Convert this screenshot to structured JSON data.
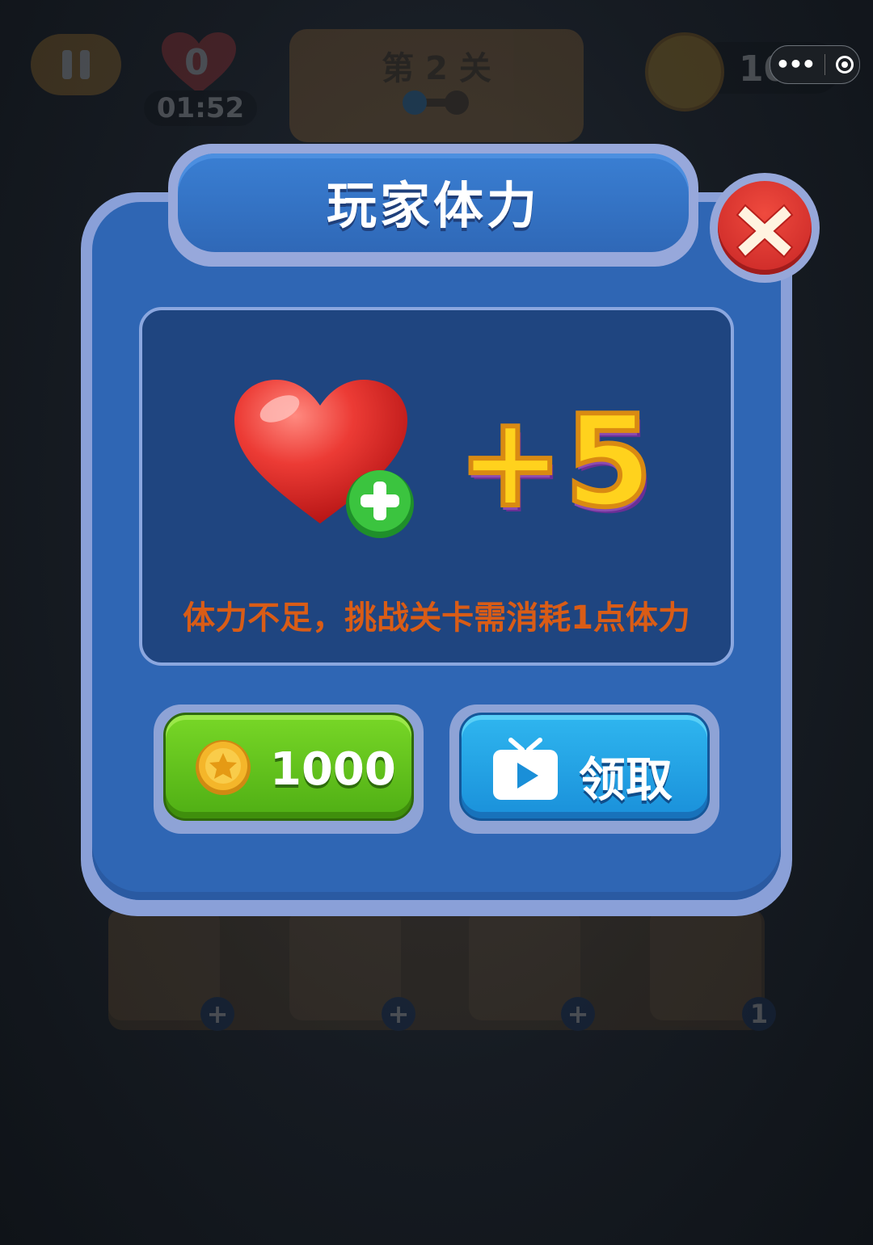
{
  "hud": {
    "lives": "0",
    "timer": "01:52",
    "level_title": "第 2 关",
    "coins": "1020",
    "tool_badge": "1"
  },
  "dialog": {
    "title": "玩家体力",
    "reward_amount": "+5",
    "notice": "体力不足，挑战关卡需消耗1点体力",
    "coin_button_label": "1000",
    "ad_button_label": "领取"
  },
  "colors": {
    "panel_blue": "#2f66b4",
    "panel_border": "#8aa0d8",
    "notice_orange": "#d95c16",
    "reward_yellow": "#ffd21d",
    "green_button": "#5cbf18",
    "blue_button": "#1f9fe3",
    "close_red": "#d63228"
  },
  "icons": {
    "pause": "pause-icon",
    "heart": "heart-icon",
    "coin": "star-coin-icon",
    "close": "close-icon",
    "video": "tv-video-icon",
    "tools": [
      "undo-icon",
      "refresh-icon",
      "screwdriver-icon",
      "hammer-icon"
    ]
  }
}
